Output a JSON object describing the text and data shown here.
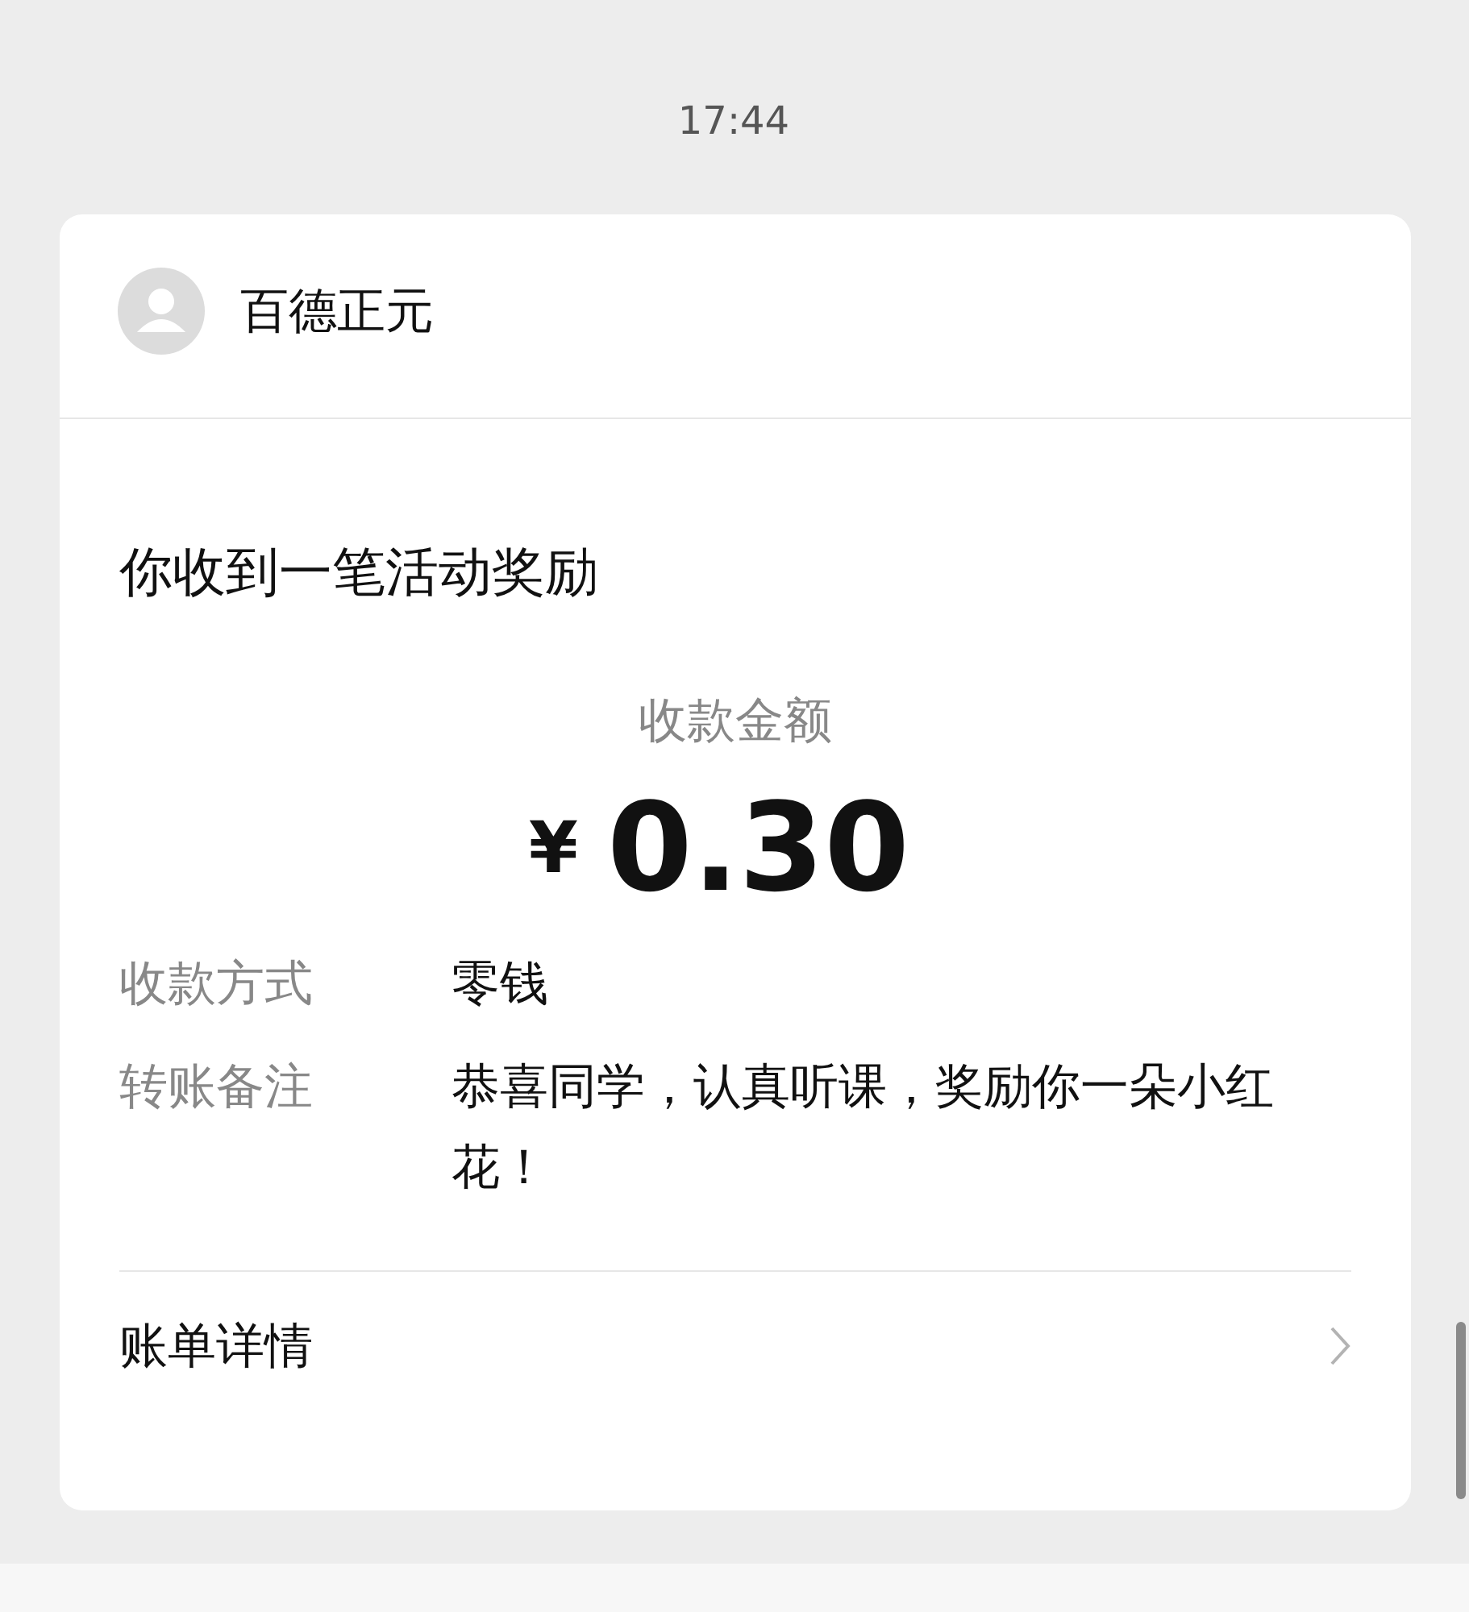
{
  "status_bar": {
    "time": "17:44"
  },
  "sender": {
    "name": "百德正元"
  },
  "title": "你收到一笔活动奖励",
  "amount": {
    "label": "收款金额",
    "currency": "¥",
    "value": "0.30"
  },
  "details": [
    {
      "label": "收款方式",
      "value": "零钱"
    },
    {
      "label": "转账备注",
      "value": "恭喜同学，认真听课，奖励你一朵小红花！"
    }
  ],
  "bill_link": {
    "label": "账单详情"
  }
}
